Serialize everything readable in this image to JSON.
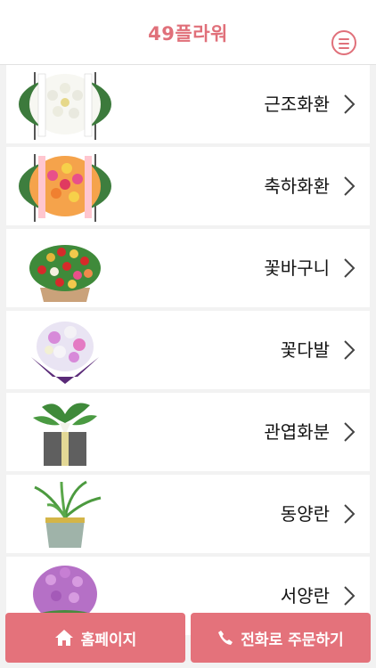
{
  "header": {
    "title": "49플라워",
    "menu_icon": "hamburger-menu-icon",
    "accent_color": "#e0707a"
  },
  "categories": [
    {
      "label": "근조화환",
      "image": "funeral-wreath-image"
    },
    {
      "label": "축하화환",
      "image": "celebration-wreath-image"
    },
    {
      "label": "꽃바구니",
      "image": "flower-basket-image"
    },
    {
      "label": "꽃다발",
      "image": "bouquet-image"
    },
    {
      "label": "관엽화분",
      "image": "foliage-plant-pot-image"
    },
    {
      "label": "동양란",
      "image": "oriental-orchid-image"
    },
    {
      "label": "서양란",
      "image": "western-orchid-image"
    }
  ],
  "bottom_bar": {
    "home_label": "홈페이지",
    "call_label": "전화로 주문하기",
    "button_color": "#e4727b"
  }
}
